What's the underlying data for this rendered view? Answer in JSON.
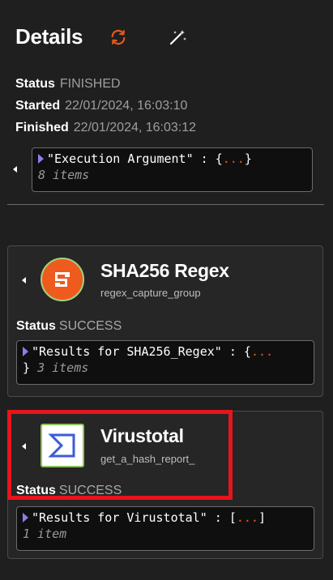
{
  "details": {
    "title": "Details",
    "status_label": "Status",
    "status_value": "FINISHED",
    "started_label": "Started",
    "started_value": "22/01/2024, 16:03:10",
    "finished_label": "Finished",
    "finished_value": "22/01/2024, 16:03:12",
    "argument": {
      "key": "\"Execution Argument\"",
      "colon": " : ",
      "open": "{",
      "dots": "...",
      "close": "}",
      "count": "8 items"
    }
  },
  "actions": [
    {
      "name": "SHA256 Regex",
      "subtitle": "regex_capture_group",
      "status_label": "Status",
      "status_value": "SUCCESS",
      "result": {
        "key": "\"Results for SHA256_Regex\"",
        "colon": " : ",
        "open": "{",
        "dots": "...",
        "close": "}",
        "count": "3 items"
      }
    },
    {
      "name": "Virustotal",
      "subtitle": "get_a_hash_report_",
      "status_label": "Status",
      "status_value": "SUCCESS",
      "result": {
        "key": "\"Results for Virustotal\"",
        "colon": " : ",
        "open": "[",
        "dots": "...",
        "close": "]",
        "count": "1 item"
      }
    }
  ],
  "icons": {
    "rerun": "refresh-icon",
    "magic": "magic-wand-icon",
    "collapse": "caret-left-icon",
    "expand": "triangle-right-icon"
  },
  "colors": {
    "background": "#1f1f1f",
    "accent_orange": "#e3591c",
    "triangle_purple": "#8a7fe8",
    "highlight_red": "#e8141b",
    "virustotal_blue": "#3b5bdb"
  }
}
